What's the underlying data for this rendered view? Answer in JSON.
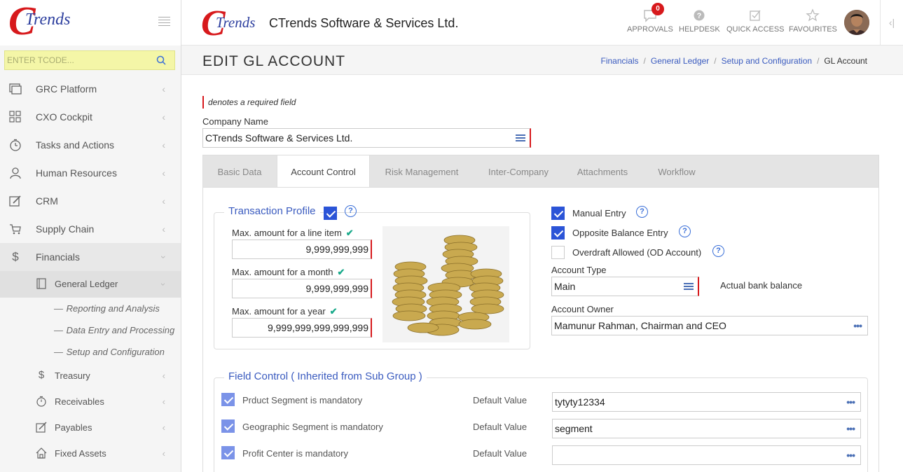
{
  "brand": {
    "logo_c": "C",
    "logo_text": "Trends",
    "company": "CTrends Software & Services Ltd."
  },
  "sidebar": {
    "tcode_placeholder": "ENTER TCODE...",
    "items": [
      {
        "label": "GRC Platform",
        "icon": "monitor-icon"
      },
      {
        "label": "CXO Cockpit",
        "icon": "grid-icon"
      },
      {
        "label": "Tasks and Actions",
        "icon": "clock-icon"
      },
      {
        "label": "Human Resources",
        "icon": "user-icon"
      },
      {
        "label": "CRM",
        "icon": "edit-icon"
      },
      {
        "label": "Supply Chain",
        "icon": "cart-icon"
      },
      {
        "label": "Financials",
        "icon": "dollar-icon"
      }
    ],
    "financials_sub": {
      "general_ledger": "General Ledger",
      "leaves": [
        "Reporting and Analysis",
        "Data Entry and Processing",
        "Setup and Configuration"
      ],
      "others": [
        "Treasury",
        "Receivables",
        "Payables",
        "Fixed Assets"
      ]
    }
  },
  "header": {
    "approvals": "APPROVALS",
    "approvals_count": "0",
    "helpdesk": "HELPDESK",
    "quick_access": "QUICK ACCESS",
    "favourites": "FAVOURITES"
  },
  "page": {
    "title": "EDIT GL ACCOUNT",
    "breadcrumb": [
      "Financials",
      "General Ledger",
      "Setup and Configuration",
      "GL Account"
    ],
    "required_note": "denotes a required field",
    "company_label": "Company Name",
    "company_value": "CTrends Software & Services Ltd."
  },
  "tabs": [
    "Basic Data",
    "Account Control",
    "Risk Management",
    "Inter-Company",
    "Attachments",
    "Workflow"
  ],
  "transaction_profile": {
    "legend": "Transaction Profile",
    "line_label": "Max. amount for a line item",
    "line_value": "9,999,999,999",
    "month_label": "Max. amount for a month",
    "month_value": "9,999,999,999",
    "year_label": "Max. amount for a year",
    "year_value": "9,999,999,999,999,999"
  },
  "account_control": {
    "manual_entry": "Manual Entry",
    "opposite_balance": "Opposite Balance Entry",
    "overdraft": "Overdraft Allowed (OD Account)",
    "account_type_label": "Account Type",
    "account_type_value": "Main",
    "account_type_desc": "Actual bank balance",
    "owner_label": "Account Owner",
    "owner_value": "Mamunur Rahman, Chairman and CEO"
  },
  "field_control": {
    "legend": "Field Control ( Inherited from Sub Group )",
    "default_label": "Default Value",
    "rows": [
      {
        "label": "Prduct Segment is mandatory",
        "value": "tytyty12334"
      },
      {
        "label": "Geographic Segment is mandatory",
        "value": "segment"
      },
      {
        "label": "Profit Center is mandatory",
        "value": ""
      }
    ]
  },
  "colors": {
    "accent": "#2b54d7",
    "brand_red": "#d7191c",
    "link": "#3a5bbf"
  }
}
